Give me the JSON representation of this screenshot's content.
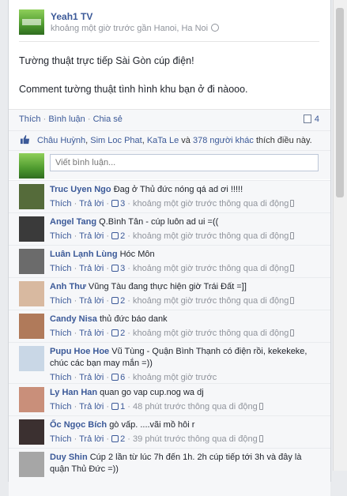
{
  "post": {
    "page_name": "Yeah1 TV",
    "meta": "khoảng một giờ trước gần Hanoi, Ha Noi",
    "lines": [
      "Tường thuật trực tiếp Sài Gòn cúp điện!",
      "Comment tường thuật tình hình khu bạn ở đi nàooo."
    ]
  },
  "actions": {
    "like": "Thích",
    "comment": "Bình luận",
    "share": "Chia sẻ",
    "comment_count": "4"
  },
  "likes": {
    "names": [
      "Châu Huỳnh",
      "Sim Loc Phat",
      "KaTa Le"
    ],
    "connector": "và",
    "others": "378 người khác",
    "suffix": "thích điều này."
  },
  "compose": {
    "placeholder": "Viết bình luận..."
  },
  "comment_actions": {
    "like": "Thích",
    "reply": "Trả lời"
  },
  "comments": [
    {
      "name": "Truc Uyen Ngo",
      "text": "Đag ở Thủ đức nóng qá ad ơi !!!!!",
      "likes": "3",
      "time": "khoảng một giờ trước thông qua di động",
      "mobile": true
    },
    {
      "name": "Angel Tang",
      "text": "Q.Bình Tân - cúp luôn ad ui =((",
      "likes": "2",
      "time": "khoảng một giờ trước thông qua di động",
      "mobile": true
    },
    {
      "name": "Luân Lạnh Lùng",
      "text": "Hóc Môn",
      "likes": "3",
      "time": "khoảng một giờ trước thông qua di động",
      "mobile": true
    },
    {
      "name": "Anh Thư",
      "text": "Vũng Tàu đang thực hiện giờ Trái Đất =]]",
      "likes": "2",
      "time": "khoảng một giờ trước thông qua di động",
      "mobile": true
    },
    {
      "name": "Candy Nisa",
      "text": "thủ đức báo dank",
      "likes": "2",
      "time": "khoảng một giờ trước thông qua di động",
      "mobile": true
    },
    {
      "name": "Pupu Hoe Hoe",
      "text": "Vũ Tùng - Quận Bình Thạnh có điện rồi, kekekeke, chúc các bạn may mắn =))",
      "likes": "6",
      "time": "khoảng một giờ trước",
      "mobile": false
    },
    {
      "name": "Ly Han Han",
      "text": "quan go vap cup.nog wa dj",
      "likes": "1",
      "time": "48 phút trước thông qua di động",
      "mobile": true
    },
    {
      "name": "Ốc Ngọc Bích",
      "text": "gò vấp. ....vãi mồ hôi r",
      "likes": "2",
      "time": "39 phút trước thông qua di động",
      "mobile": true
    },
    {
      "name": "Duy Shin",
      "text": "Cúp 2 lần từ lúc 7h đến 1h. 2h cúp tiếp tới 3h và đây là quận Thủ Đức =))",
      "likes": "",
      "time": "",
      "mobile": false
    }
  ],
  "colors": {
    "link": "#3b5998",
    "meta": "#90949c",
    "panel": "#f6f7f9"
  }
}
